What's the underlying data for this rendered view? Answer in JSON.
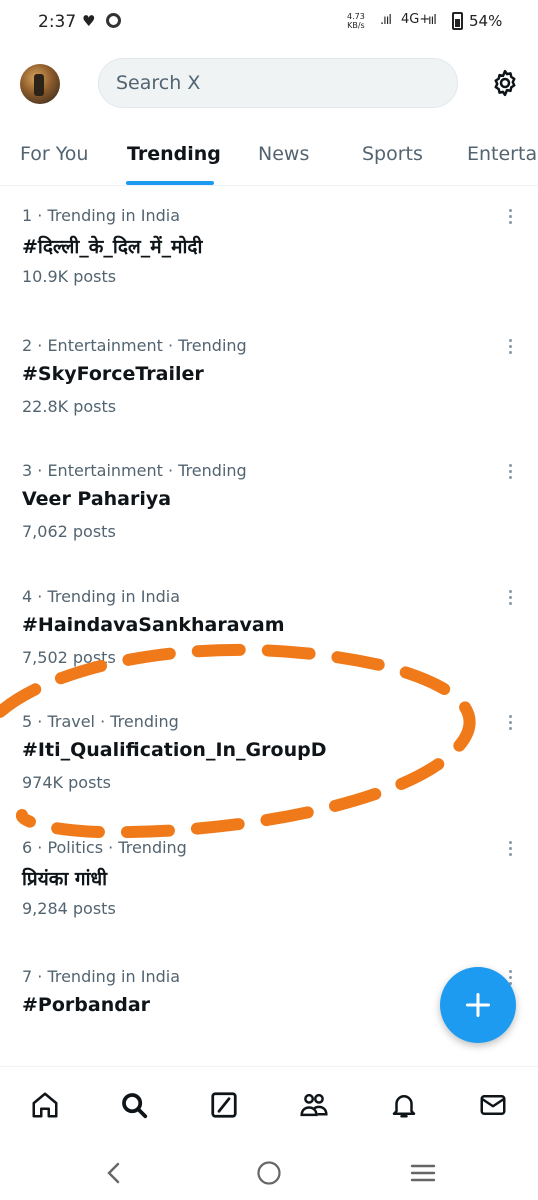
{
  "status_bar": {
    "time": "2:37",
    "speed_value": "4.73",
    "speed_unit": "KB/s",
    "network": "4G+",
    "battery": "54%"
  },
  "header": {
    "search_placeholder": "Search X"
  },
  "tabs": [
    {
      "label": "For You",
      "active": false
    },
    {
      "label": "Trending",
      "active": true
    },
    {
      "label": "News",
      "active": false
    },
    {
      "label": "Sports",
      "active": false
    },
    {
      "label": "Enterta",
      "active": false
    }
  ],
  "trends": [
    {
      "context": "1 · Trending in India",
      "title": "#दिल्ली_के_दिल_में_मोदी",
      "posts": "10.9K posts"
    },
    {
      "context": "2 · Entertainment · Trending",
      "title": "#SkyForceTrailer",
      "posts": "22.8K posts"
    },
    {
      "context": "3 · Entertainment · Trending",
      "title": "Veer Pahariya",
      "posts": "7,062 posts"
    },
    {
      "context": "4 · Trending in India",
      "title": "#HaindavaSankharavam",
      "posts": "7,502 posts"
    },
    {
      "context": "5 · Travel · Trending",
      "title": "#Iti_Qualification_In_GroupD",
      "posts": "974K posts"
    },
    {
      "context": "6 · Politics · Trending",
      "title": "प्रियंका गांधी",
      "posts": "9,284 posts"
    },
    {
      "context": "7 · Trending in India",
      "title": "#Porbandar",
      "posts": ""
    }
  ],
  "icons": {
    "settings": "gear-icon",
    "fab": "plus-icon",
    "nav": [
      "home-icon",
      "search-icon",
      "grok-icon",
      "communities-icon",
      "bell-icon",
      "mail-icon"
    ],
    "system": [
      "back-icon",
      "home-circle-icon",
      "recents-icon"
    ]
  },
  "colors": {
    "accent": "#1d9bf0",
    "annotation": "#f07a1a",
    "secondary_text": "#536471"
  }
}
